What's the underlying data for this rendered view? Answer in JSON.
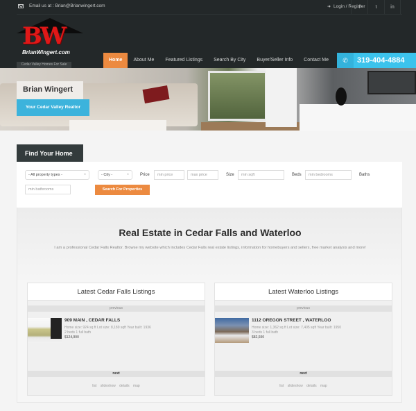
{
  "topbar": {
    "email": "Email us at : Brian@Brianwingert.com",
    "login": "Login / Register",
    "social": [
      {
        "icon": "facebook-icon",
        "glyph": "f"
      },
      {
        "icon": "twitter-icon",
        "glyph": "t"
      },
      {
        "icon": "linkedin-icon",
        "glyph": "in"
      }
    ]
  },
  "logo": {
    "mark": "BW",
    "name": "BrianWingert.com",
    "tagline": "Cedar Valley Homes For Sale"
  },
  "nav": {
    "items": [
      "Home",
      "About Me",
      "Featured Listings",
      "Search By City",
      "Buyer/Seller Info",
      "Contact Me"
    ],
    "active": "Home",
    "phone": "319-404-4884",
    "phone_icon": "✆"
  },
  "hero": {
    "name": "Brian Wingert",
    "subtitle": "Your Cedar Valley Realtor"
  },
  "search": {
    "title": "Find Your Home",
    "property_type": "- All property types -",
    "city": "- City -",
    "price_label": "Price",
    "min_price_placeholder": "min price",
    "max_price_placeholder": "max price",
    "size_label": "Size",
    "min_sqft_placeholder": "min sqft",
    "beds_label": "Beds",
    "min_bedrooms_placeholder": "min bedrooms",
    "baths_label": "Baths",
    "min_bathrooms_placeholder": "min bathrooms",
    "button": "Search For Properties"
  },
  "content": {
    "title": "Real Estate in Cedar Falls and Waterloo",
    "intro": "I am a professional Cedar Falls Realtor. Browse my website which includes Cedar Falls real estate listings, information for homebuyers and sellers, free market analysis and more!"
  },
  "listings": [
    {
      "heading": "Latest Cedar Falls Listings",
      "previous": "previous",
      "next": "next",
      "address": "909 MAIN , CEDAR FALLS",
      "details": "Home size: 924 sq ft Lot size: 8,189 sqft Year built: 1936",
      "rooms": "2 beds 1 full bath",
      "price": "$124,900",
      "views": [
        "list",
        "slideshow",
        "details",
        "map"
      ]
    },
    {
      "heading": "Latest Waterloo Listings",
      "previous": "previous",
      "next": "next",
      "address": "1112 OREGON STREET , WATERLOO",
      "details": "Home size: 1,362 sq ft Lot size: 7,405 sqft Year built: 1950",
      "rooms": "3 beds 1 full bath",
      "price": "$82,500",
      "views": [
        "list",
        "slideshow",
        "details",
        "map"
      ]
    }
  ]
}
